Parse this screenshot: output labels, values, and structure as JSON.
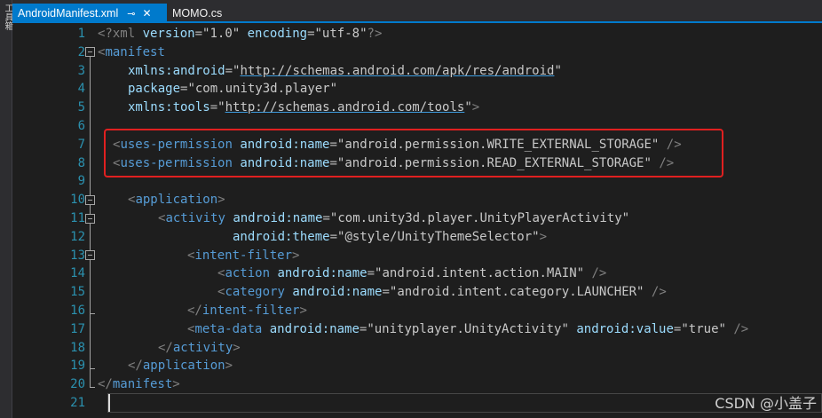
{
  "toolstrip": {
    "label": "工具箱"
  },
  "tabs": [
    {
      "label": "AndroidManifest.xml",
      "active": true,
      "pin_icon": "pin-icon",
      "close_icon": "close-icon"
    },
    {
      "label": "MOMO.cs",
      "active": false
    }
  ],
  "line_numbers": [
    "1",
    "2",
    "3",
    "4",
    "5",
    "6",
    "7",
    "8",
    "9",
    "10",
    "11",
    "12",
    "13",
    "14",
    "15",
    "16",
    "17",
    "18",
    "19",
    "20",
    "21"
  ],
  "code": {
    "l1": {
      "t1": "<?xml ",
      "a1": "version",
      "e1": "=",
      "v1": "\"1.0\"",
      "sp": " ",
      "a2": "encoding",
      "e2": "=",
      "v2": "\"utf-8\"",
      "t2": "?>"
    },
    "l2": {
      "t1": "<",
      "el": "manifest"
    },
    "l3": {
      "a": "xmlns:android",
      "e": "=",
      "q1": "\"",
      "url": "http://schemas.android.com/apk/res/android",
      "q2": "\""
    },
    "l4": {
      "a": "package",
      "e": "=",
      "v": "\"com.unity3d.player\""
    },
    "l5": {
      "a": "xmlns:tools",
      "e": "=",
      "q1": "\"",
      "url": "http://schemas.android.com/tools",
      "q2": "\"",
      "close": ">"
    },
    "l7": {
      "o": "<",
      "el": "uses-permission",
      "a": "android:name",
      "e": "=",
      "v": "\"android.permission.WRITE_EXTERNAL_STORAGE\"",
      "c": " />"
    },
    "l8": {
      "o": "<",
      "el": "uses-permission",
      "a": "android:name",
      "e": "=",
      "v": "\"android.permission.READ_EXTERNAL_STORAGE\"",
      "c": " />"
    },
    "l10": {
      "o": "<",
      "el": "application",
      "c": ">"
    },
    "l11": {
      "o": "<",
      "el": "activity",
      "a": "android:name",
      "e": "=",
      "v": "\"com.unity3d.player.UnityPlayerActivity\""
    },
    "l12": {
      "a": "android:theme",
      "e": "=",
      "v": "\"@style/UnityThemeSelector\"",
      "c": ">"
    },
    "l13": {
      "o": "<",
      "el": "intent-filter",
      "c": ">"
    },
    "l14": {
      "o": "<",
      "el": "action",
      "a": "android:name",
      "e": "=",
      "v": "\"android.intent.action.MAIN\"",
      "c": " />"
    },
    "l15": {
      "o": "<",
      "el": "category",
      "a": "android:name",
      "e": "=",
      "v": "\"android.intent.category.LAUNCHER\"",
      "c": " />"
    },
    "l16": {
      "o": "</",
      "el": "intent-filter",
      "c": ">"
    },
    "l17": {
      "o": "<",
      "el": "meta-data",
      "a": "android:name",
      "e": "=",
      "v": "\"unityplayer.UnityActivity\"",
      "a2": "android:value",
      "e2": "=",
      "v2": "\"true\"",
      "c": " />"
    },
    "l18": {
      "o": "</",
      "el": "activity",
      "c": ">"
    },
    "l19": {
      "o": "</",
      "el": "application",
      "c": ">"
    },
    "l20": {
      "o": "</",
      "el": "manifest",
      "c": ">"
    }
  },
  "watermark": "CSDN @小盖子",
  "colors": {
    "accent": "#007acc",
    "highlight_box": "#e02020",
    "line_number": "#2b91af",
    "element": "#569cd6",
    "attribute": "#9cdcfe"
  }
}
